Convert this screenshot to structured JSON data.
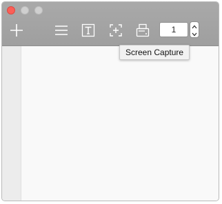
{
  "window": {
    "controls": [
      "close",
      "minimize",
      "maximize"
    ]
  },
  "toolbar": {
    "icons": [
      "plus-icon",
      "list-icon",
      "text-icon",
      "screen-capture-icon",
      "scanner-icon"
    ],
    "page_number": "1"
  },
  "tooltip": {
    "text": "Screen Capture"
  },
  "colors": {
    "toolbar_bg": "#a4a4a4",
    "close_button": "#fc5f57",
    "content_bg": "#f9f9f9",
    "sidebar_bg": "#ececec"
  }
}
